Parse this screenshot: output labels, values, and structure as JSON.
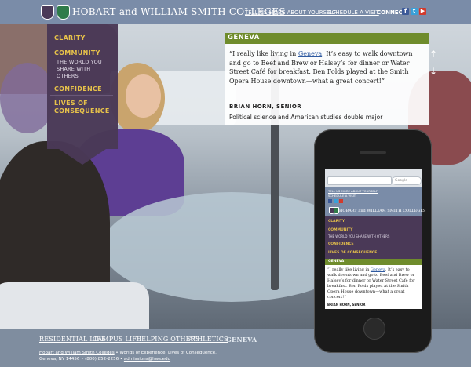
{
  "header": {
    "logo_text": "HOBART and WILLIAM SMITH COLLEGES",
    "links": [
      "TELL US MORE ABOUT YOURSELF",
      "SCHEDULE A VISIT"
    ],
    "connect_label": "CONNECT:",
    "social_icons": [
      "facebook-icon",
      "twitter-icon",
      "youtube-icon"
    ]
  },
  "nav": {
    "items": [
      {
        "label": "CLARITY"
      },
      {
        "label": "COMMUNITY",
        "sub": [
          "THE WORLD YOU",
          "SHARE WITH",
          "OTHERS"
        ]
      },
      {
        "label": "CONFIDENCE"
      },
      {
        "label": "LIVES OF",
        "label2": "CONSEQUENCE"
      }
    ]
  },
  "feature": {
    "section": "GENEVA",
    "quote_pre": "“I really like living in ",
    "quote_link": "Geneva",
    "quote_post": ". It’s easy to walk downtown and go to Beef and Brew or Halsey’s for dinner or Water Street Café for breakfast. Ben Folds played at the Smith Opera House downtown—what a great concert!”",
    "author": "BRIAN HORN, SENIOR",
    "major": "Political science and American studies double major"
  },
  "phone": {
    "search_placeholder": "Google",
    "links": [
      "TELL US MORE ABOUT YOURSELF",
      "SCHEDULE A VISIT"
    ],
    "logo_text": "HOBART and WILLIAM SMITH COLLEGES",
    "nav": [
      "CLARITY",
      "COMMUNITY",
      "THE WORLD YOU SHARE WITH OTHERS",
      "CONFIDENCE",
      "LIVES OF CONSEQUENCE"
    ],
    "section": "GENEVA",
    "quote_pre": "“I really like living in ",
    "quote_link": "Geneva",
    "quote_post": ". It’s easy to walk downtown and go to Beef and Brew or Halsey’s for dinner or Water Street Café for breakfast. Ben Folds played at the Smith Opera House downtown—what a great concert!”",
    "author": "BRIAN HORN, SENIOR"
  },
  "bottom_nav": {
    "items": [
      "RESIDENTIAL LIFE",
      "CAMPUS LIFE",
      "HELPING OTHERS",
      "ATHLETICS",
      "GENEVA"
    ],
    "active": "GENEVA"
  },
  "footer": {
    "line1_link": "Hobart and William Smith Colleges",
    "line1_rest": " • Worlds of Experience. Lives of Consequence.",
    "line2_pre": "Geneva, NY 14456 • (800) 852-2256 • ",
    "line2_link": "admissions@hws.edu"
  },
  "colors": {
    "header_bg": "#7a8ca8",
    "nav_purple": "#4a3957",
    "nav_gold": "#e7c24a",
    "geneva_green": "#6f8c2c",
    "link_blue": "#2f5aa0"
  }
}
